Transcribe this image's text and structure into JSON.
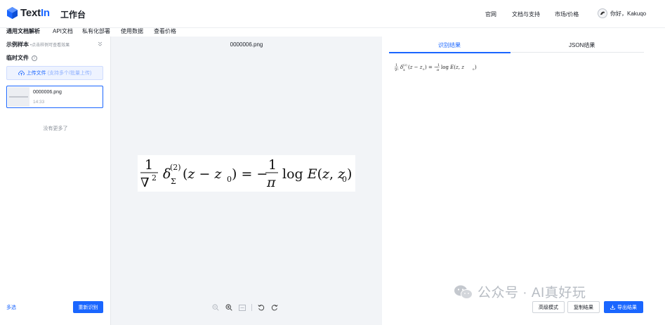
{
  "header": {
    "logo_text_prefix": "Text",
    "logo_text_suffix": "In",
    "workspace": "工作台",
    "nav": [
      "官网",
      "文档与支持",
      "市场/价格"
    ],
    "user_greeting": "你好，Kakuqo"
  },
  "subnav": {
    "items": [
      "通用文档解析",
      "API文档",
      "私有化部署",
      "使用数据",
      "查看价格"
    ],
    "active_index": 0
  },
  "left_panel": {
    "samples_title": "示例样本",
    "samples_hint": "•点击样例可查看效果",
    "temp_files_title": "临时文件",
    "upload_label": "上传文件",
    "upload_hint": "(支持多个/批量上传)",
    "files": [
      {
        "name": "0000006.png",
        "time": "14:33"
      }
    ],
    "no_more": "没有更多了",
    "multi_select": "多选",
    "rerecognize": "重新识别"
  },
  "viewer": {
    "file_title": "0000006.png"
  },
  "result_panel": {
    "tabs": [
      "识别结果",
      "JSON结果"
    ],
    "active_tab": 0,
    "buttons": {
      "advanced": "高级模式",
      "copy": "复制结果",
      "export": "导出结果"
    }
  },
  "watermark": {
    "text": "公众号 · AI真好玩"
  },
  "colors": {
    "accent": "#1a66ff",
    "panel_bg": "#f2f4f7"
  }
}
